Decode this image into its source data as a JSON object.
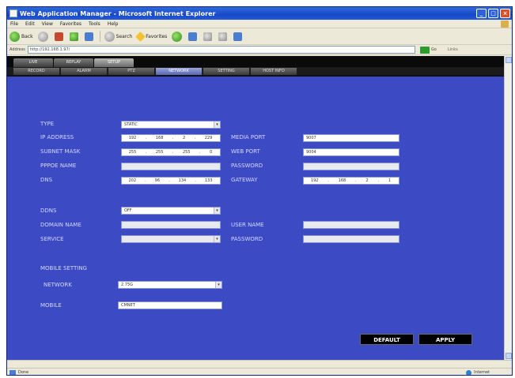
{
  "window": {
    "title": "Web Application Manager - Microsoft Internet Explorer"
  },
  "menu": [
    "File",
    "Edit",
    "View",
    "Favorites",
    "Tools",
    "Help"
  ],
  "toolbar": {
    "back": "Back",
    "search": "Search",
    "favorites": "Favorites"
  },
  "address": {
    "label": "Address",
    "url": "http://192.168.1.97/",
    "go": "Go",
    "links": "Links"
  },
  "tabs_main": [
    "LIVE",
    "REPLAY",
    "SETUP"
  ],
  "tabs_sub": [
    "RECORD",
    "ALARM",
    "PTZ",
    "NETWORK",
    "SETTING",
    "HOST INFO"
  ],
  "form": {
    "type_label": "TYPE",
    "type_value": "STATIC",
    "ip_label": "IP ADDRESS",
    "ip": [
      "192",
      "168",
      "2",
      "229"
    ],
    "subnet_label": "SUBNET MASK",
    "subnet": [
      "255",
      "255",
      "255",
      "0"
    ],
    "pppoe_label": "PPPOE NAME",
    "dns_label": "DNS",
    "dns": [
      "202",
      "96",
      "134",
      "133"
    ],
    "media_port_label": "MEDIA PORT",
    "media_port": "9007",
    "web_port_label": "WEB PORT",
    "web_port": "9004",
    "password_label": "PASSWORD",
    "gateway_label": "GATEWAY",
    "gateway": [
      "192",
      "168",
      "2",
      "1"
    ],
    "ddns_label": "DDNS",
    "ddns_value": "OFF",
    "domain_label": "DOMAIN NAME",
    "service_label": "SERVICE",
    "username_label": "USER NAME",
    "password2_label": "PASSWORD",
    "mobile_setting_label": "MOBILE SETTING",
    "network_label": "NETWORK",
    "network_value": "2.75G",
    "mobile_label": "MOBILE",
    "mobile_value": "CMNET"
  },
  "buttons": {
    "default": "DEFAULT",
    "apply": "APPLY"
  },
  "status": {
    "done": "Done",
    "zone": "Internet"
  }
}
